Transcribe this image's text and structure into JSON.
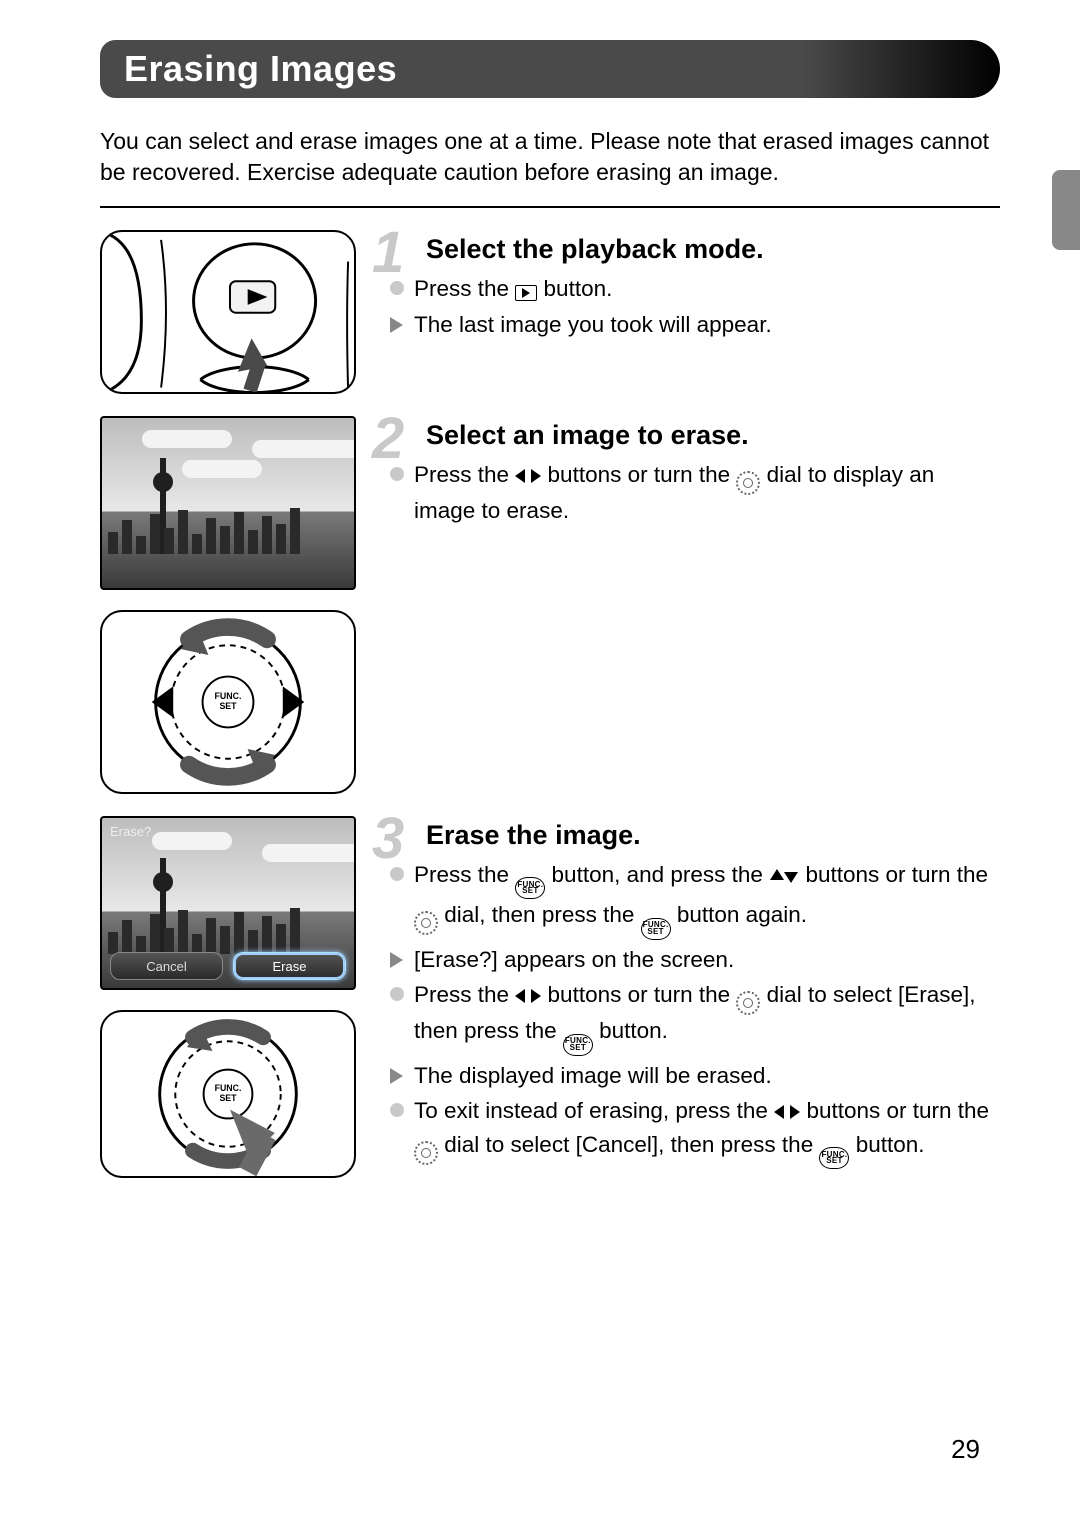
{
  "page_number": "29",
  "title": "Erasing Images",
  "intro": "You can select and erase images one at a time. Please note that erased images cannot be recovered. Exercise adequate caution before erasing an image.",
  "steps": [
    {
      "num": "1",
      "heading": "Select the playback mode.",
      "lines": [
        {
          "kind": "dot",
          "segments": [
            "Press the ",
            {
              "icon": "playback"
            },
            " button."
          ]
        },
        {
          "kind": "tri",
          "segments": [
            "The last image you took will appear."
          ]
        }
      ]
    },
    {
      "num": "2",
      "heading": "Select an image to erase.",
      "lines": [
        {
          "kind": "dot",
          "segments": [
            "Press the ",
            {
              "icon": "lr"
            },
            " buttons or turn the ",
            {
              "icon": "ring"
            },
            " dial to display an image to erase."
          ]
        }
      ]
    },
    {
      "num": "3",
      "heading": "Erase the image.",
      "lines": [
        {
          "kind": "dot",
          "segments": [
            "Press the ",
            {
              "icon": "func"
            },
            " button, and press the ",
            {
              "icon": "ud"
            },
            " buttons or turn the ",
            {
              "icon": "ring"
            },
            " dial, then press the ",
            {
              "icon": "func"
            },
            " button again."
          ]
        },
        {
          "kind": "tri",
          "segments": [
            "[Erase?] appears on the screen."
          ]
        },
        {
          "kind": "dot",
          "segments": [
            "Press the ",
            {
              "icon": "lr"
            },
            " buttons or turn the ",
            {
              "icon": "ring"
            },
            " dial to select [Erase], then press the ",
            {
              "icon": "func"
            },
            " button."
          ]
        },
        {
          "kind": "tri",
          "segments": [
            "The displayed image will be erased."
          ]
        },
        {
          "kind": "dot",
          "segments": [
            "To exit instead of erasing, press the ",
            {
              "icon": "lr"
            },
            " buttons or turn the ",
            {
              "icon": "ring"
            },
            " dial to select [Cancel], then press the ",
            {
              "icon": "func"
            },
            " button."
          ]
        }
      ]
    }
  ],
  "erase_overlay": {
    "prompt": "Erase?",
    "cancel": "Cancel",
    "erase": "Erase"
  },
  "func_label_top": "FUNC.",
  "func_label_bot": "SET"
}
